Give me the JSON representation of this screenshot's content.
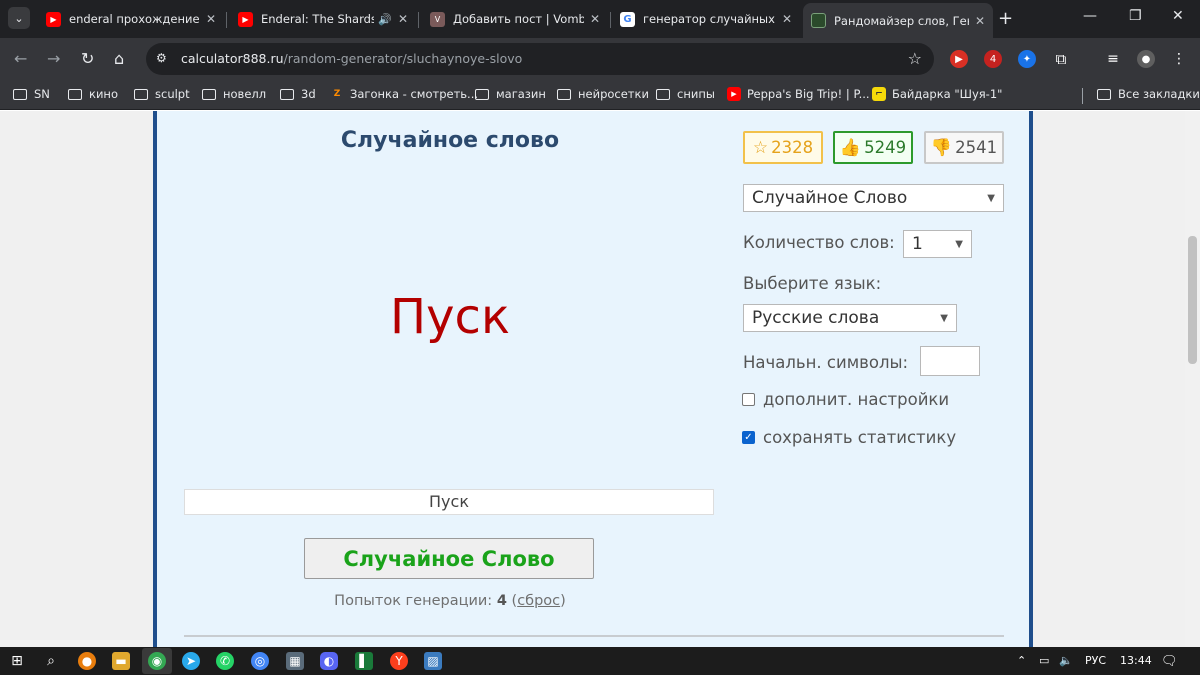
{
  "browser": {
    "tabs": [
      {
        "title": "enderal прохождение бе",
        "favicon": "youtube-icon"
      },
      {
        "title": "Enderal: The Shards o",
        "favicon": "youtube-icon"
      },
      {
        "title": "Добавить пост | Vombat",
        "favicon": "vombat-icon"
      },
      {
        "title": "генератор случайных с",
        "favicon": "google-icon"
      },
      {
        "title": "Рандомайзер слов, Генe",
        "favicon": "calculator888-icon"
      }
    ],
    "url_host": "calculator888.ru",
    "url_path": "/random-generator/sluchaynoye-slovo",
    "extension_badge": "4",
    "bookmarks": [
      "SN",
      "кино",
      "sculpt",
      "новелл",
      "3d",
      "Загонка - смотреть...",
      "магазин",
      "нейросетки",
      "снипы",
      "Peppa's Big Trip! | P...",
      "Байдарка \"Шуя-1\""
    ],
    "all_bookmarks": "Все закладки"
  },
  "page": {
    "title": "Случайное слово",
    "result_word": "Пуск",
    "result_field": "Пуск",
    "generate_button": "Случайное Слово",
    "attempts_label": "Попыток генерации:",
    "attempts_count": "4",
    "reset_label": "сброс",
    "favorites_count": "2328",
    "likes_count": "5249",
    "dislikes_count": "2541",
    "mode_select": "Случайное Слово",
    "count_label": "Количество слов:",
    "count_select": "1",
    "language_label": "Выберите язык:",
    "language_select": "Русские слова",
    "start_chars_label": "Начальн. символы:",
    "start_chars_value": "",
    "extra_settings_label": "дополнит. настройки",
    "extra_settings_checked": false,
    "save_stats_label": "сохранять статистику",
    "save_stats_checked": true
  },
  "taskbar": {
    "language": "РУС",
    "time": "13:44"
  },
  "colors": {
    "panel_bg": "#e8f4fd",
    "panel_border": "#1f4e8c",
    "result_word": "#b30000",
    "generate_text": "#1aa31a",
    "title": "#2c4a6e"
  }
}
